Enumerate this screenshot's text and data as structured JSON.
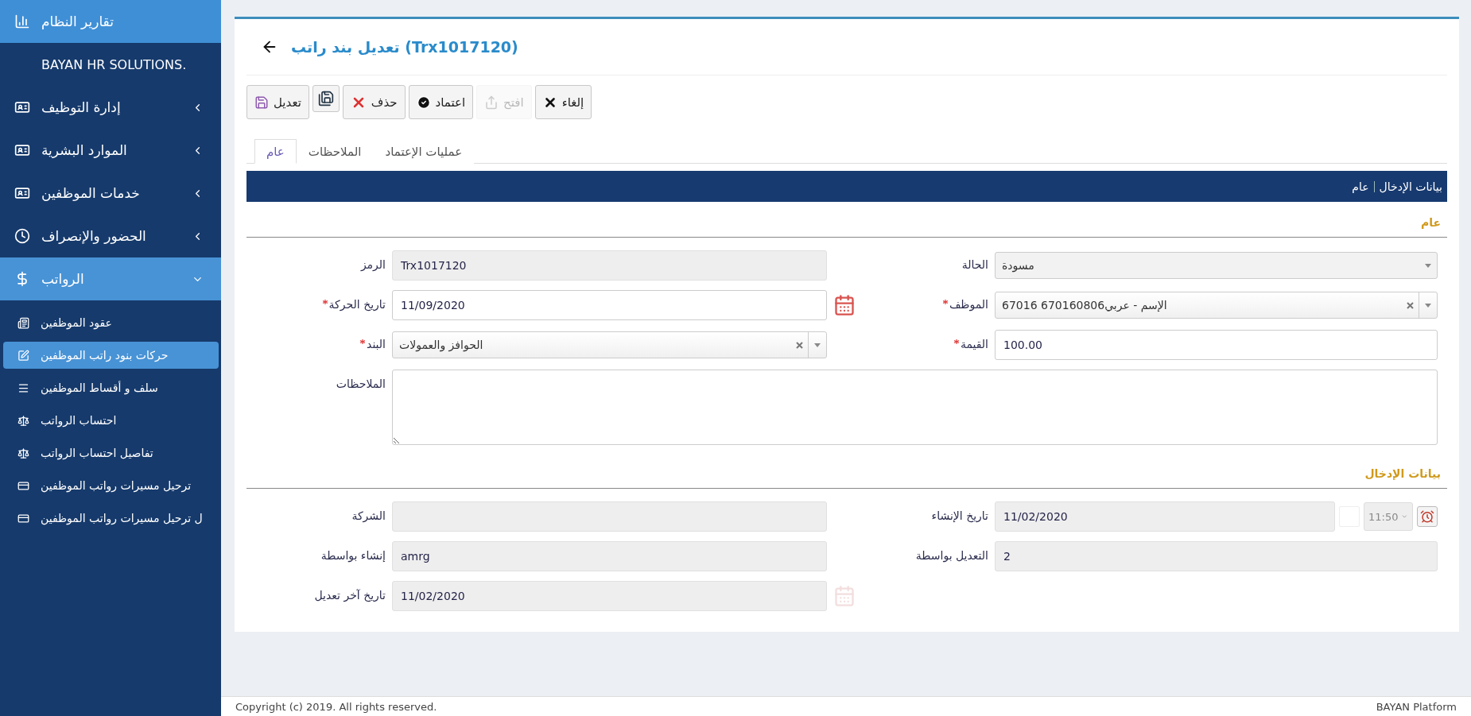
{
  "sidebar": {
    "top_item": {
      "label": "تقارير النظام"
    },
    "brand": "BAYAN HR SOLUTIONS.",
    "items": [
      {
        "label": "إدارة التوظيف",
        "selected": false,
        "expanded": false
      },
      {
        "label": "الموارد البشرية",
        "selected": false,
        "expanded": false
      },
      {
        "label": "خدمات الموظفين",
        "selected": false,
        "expanded": false
      },
      {
        "label": "الحضور والإنصراف",
        "selected": false,
        "expanded": false
      },
      {
        "label": "الرواتب",
        "selected": true,
        "expanded": true,
        "children": [
          {
            "label": "عقود الموظفين",
            "selected": false
          },
          {
            "label": "حركات بنود راتب الموظفين",
            "selected": true
          },
          {
            "label": "سلف و أقساط الموظفين",
            "selected": false
          },
          {
            "label": "احتساب الرواتب",
            "selected": false
          },
          {
            "label": "تفاصيل احتساب الرواتب",
            "selected": false
          },
          {
            "label": "ترحيل مسيرات رواتب الموظفين",
            "selected": false
          },
          {
            "label": "ل ترحيل مسيرات رواتب الموظفين",
            "selected": false
          }
        ]
      }
    ]
  },
  "page": {
    "title": "(Trx1017120) تعديل بند راتب"
  },
  "toolbar": [
    {
      "kind": "cancel",
      "label": "إلغاء",
      "disabled": false
    },
    {
      "kind": "open",
      "label": "افتح",
      "disabled": true
    },
    {
      "kind": "approve",
      "label": "اعتماد",
      "disabled": false
    },
    {
      "kind": "delete",
      "label": "حذف",
      "disabled": false
    },
    {
      "kind": "save",
      "disabled": false
    },
    {
      "kind": "edit",
      "label": "تعديل",
      "disabled": false
    }
  ],
  "tabs": [
    {
      "label": "عمليات الإعتماد",
      "selected": false
    },
    {
      "label": "الملاحظات",
      "selected": false
    },
    {
      "label": "عام",
      "selected": true
    }
  ],
  "breadcrumb": [
    "بيانات الإدخال",
    "عام"
  ],
  "sections": [
    {
      "title": "عام",
      "right": [
        {
          "label": "الحالة",
          "kind": "select",
          "value": "مسودة",
          "readonly": true,
          "required": false,
          "clearable": false
        },
        {
          "label": "الموظف",
          "kind": "select",
          "value": "الإسم - عربي670160806 67016",
          "readonly": false,
          "required": true,
          "clearable": true
        },
        {
          "label": "القيمة",
          "kind": "text",
          "value": "100.00",
          "readonly": false,
          "required": true
        }
      ],
      "left": [
        {
          "label": "الرمز",
          "kind": "text",
          "value": "Trx1017120",
          "readonly": true,
          "required": false
        },
        {
          "label": "تاريخ الحركة",
          "kind": "date",
          "value": "11/09/2020",
          "readonly": false,
          "required": true
        },
        {
          "label": "البند",
          "kind": "select",
          "value": "الحوافز والعمولات",
          "readonly": false,
          "required": true,
          "clearable": true
        }
      ],
      "wide": [
        {
          "label": "الملاحظات",
          "kind": "textarea",
          "readonly": false,
          "required": false
        }
      ]
    },
    {
      "title": "بيانات الإدخال",
      "right": [
        {
          "label": "تاريخ الإنشاء",
          "kind": "datetime",
          "value": "11/02/2020",
          "time": "11:50",
          "checked": false,
          "readonly": true,
          "required": false
        },
        {
          "label": "التعديل بواسطة",
          "kind": "text",
          "value": "2",
          "readonly": true,
          "required": false
        }
      ],
      "left": [
        {
          "label": "الشركة",
          "kind": "text",
          "readonly": true,
          "required": false
        },
        {
          "label": "إنشاء بواسطة",
          "kind": "text",
          "value": "amrg",
          "readonly": true,
          "required": false
        },
        {
          "label": "تاريخ آخر تعديل",
          "kind": "date",
          "value": "11/02/2020",
          "readonly": true,
          "required": false
        }
      ]
    }
  ],
  "footer": {
    "copyright": "Copyright (c) 2019. All rights reserved.",
    "platform": "BAYAN Platform"
  }
}
